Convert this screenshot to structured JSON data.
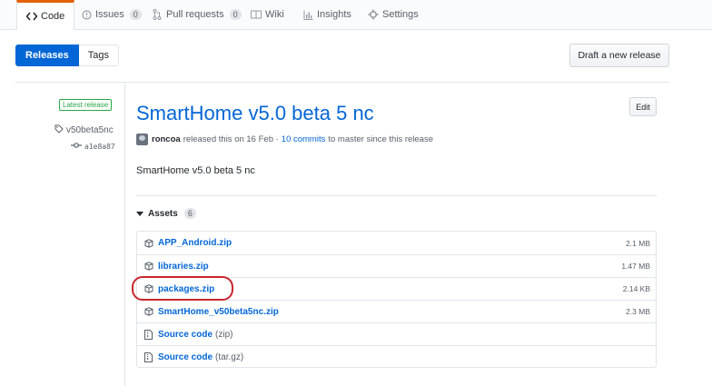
{
  "tabs": [
    {
      "label": "Code",
      "icon": "code-icon",
      "selected": true
    },
    {
      "label": "Issues",
      "icon": "issue-icon",
      "count": "0"
    },
    {
      "label": "Pull requests",
      "icon": "pull-request-icon",
      "count": "0"
    },
    {
      "label": "Wiki",
      "icon": "book-icon"
    },
    {
      "label": "Insights",
      "icon": "graph-icon"
    },
    {
      "label": "Settings",
      "icon": "gear-icon"
    }
  ],
  "subnav": {
    "releases": "Releases",
    "tags": "Tags"
  },
  "draft_button": "Draft a new release",
  "release": {
    "latest_badge": "Latest release",
    "tag": "v50beta5nc",
    "commit": "a1e8a87",
    "title": "SmartHome v5.0 beta 5 nc",
    "edit_button": "Edit",
    "author": "roncoa",
    "released_text": "released this on 16 Feb ·",
    "commits_link": "10 commits",
    "since_text": "to master since this release",
    "body": "SmartHome v5.0 beta 5 nc"
  },
  "assets": {
    "label": "Assets",
    "count": "6",
    "files": [
      {
        "name": "APP_Android.zip",
        "size": "2.1 MB"
      },
      {
        "name": "libraries.zip",
        "size": "1.47 MB"
      },
      {
        "name": "packages.zip",
        "size": "2.14 KB",
        "highlighted": true
      },
      {
        "name": "SmartHome_v50beta5nc.zip",
        "size": "2.3 MB"
      }
    ],
    "source": [
      {
        "name": "Source code",
        "ext": "(zip)"
      },
      {
        "name": "Source code",
        "ext": "(tar.gz)"
      }
    ]
  },
  "colors": {
    "accent": "#0366d6",
    "tab_highlight": "#e36209",
    "latest": "#28a745",
    "annotation": "#c8262d"
  }
}
